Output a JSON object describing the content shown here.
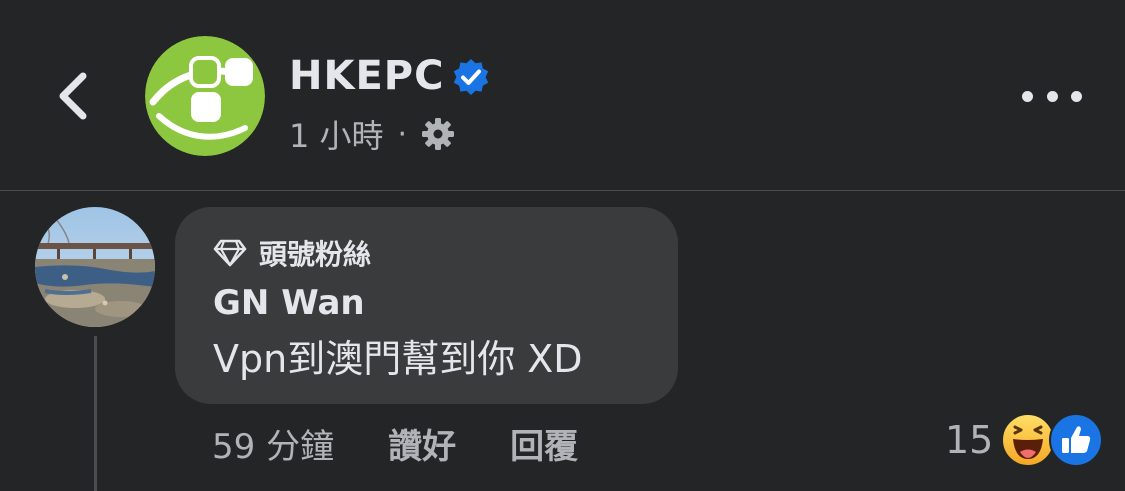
{
  "header": {
    "page_name": "HKEPC",
    "time": "1 小時",
    "separator": "·",
    "back_icon": "chevron-left-icon",
    "verified_icon": "verified-badge-icon",
    "privacy_icon": "gear-icon",
    "more_icon": "more-horizontal-icon"
  },
  "comment": {
    "badge": "頭號粉絲",
    "badge_icon": "diamond-icon",
    "author": "GN Wan",
    "text": "Vpn到澳門幫到你 XD",
    "time": "59 分鐘",
    "like_label": "讚好",
    "reply_label": "回覆",
    "reaction_count": "15",
    "reaction_icons": [
      "haha-icon",
      "like-icon"
    ]
  },
  "colors": {
    "background": "#242526",
    "bubble": "#3a3b3c",
    "primary_text": "#e4e6eb",
    "secondary_text": "#b0b3b8",
    "verified_blue": "#1b74e4",
    "logo_green": "#8dc63f"
  }
}
